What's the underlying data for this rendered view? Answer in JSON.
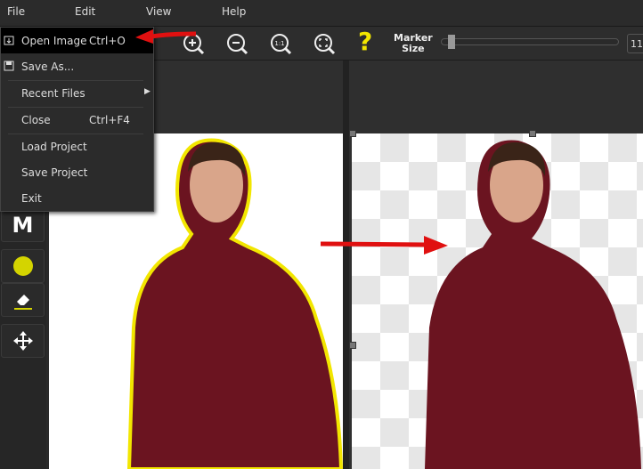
{
  "menubar": {
    "items": [
      {
        "label": "File"
      },
      {
        "label": "Edit"
      },
      {
        "label": "View"
      },
      {
        "label": "Help"
      }
    ]
  },
  "toolbar": {
    "marker_label_1": "Marker",
    "marker_label_2": "Size",
    "marker_size_value": "11",
    "marker_size_fraction": 0.02,
    "help_glyph": "?",
    "zoom_actual_glyph": "1:1"
  },
  "left_tools": {
    "manual_label": "M",
    "brush_color": "#d4d400"
  },
  "file_menu": {
    "items": [
      {
        "label": "Open Image",
        "shortcut": "Ctrl+O",
        "icon": "open-icon"
      },
      {
        "label": "Save As...",
        "icon": "save-icon"
      },
      {
        "label": "Recent Files",
        "submenu": true
      },
      {
        "label": "Close",
        "shortcut": "Ctrl+F4"
      },
      {
        "label": "Load Project"
      },
      {
        "label": "Save Project"
      },
      {
        "label": "Exit"
      }
    ]
  },
  "colors": {
    "outline": "#f2e600",
    "shirt": "#6b1420",
    "arrow": "#e01010"
  }
}
